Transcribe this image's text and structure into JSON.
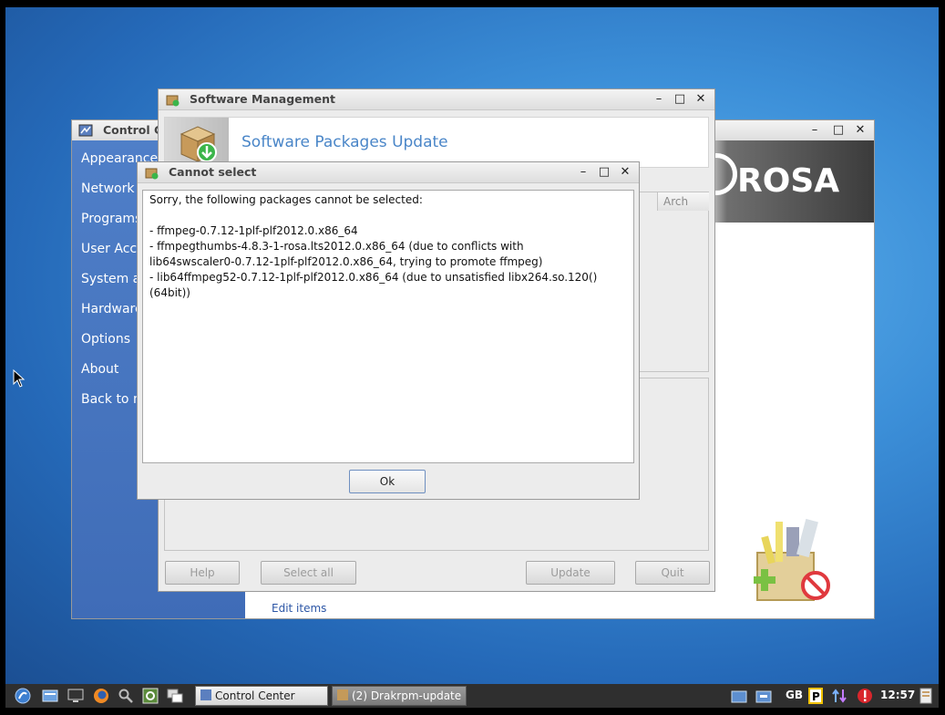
{
  "control_center": {
    "title": "Control C",
    "sidebar": [
      "Appearance",
      "Network &",
      "Programs",
      "User Acco",
      "System ar",
      "Hardware",
      "Options",
      "About",
      "Back to m"
    ],
    "edit_items_link": "Edit items",
    "brand_text": "ROSA"
  },
  "software_management": {
    "title": "Software Management",
    "header_title": "Software Packages Update",
    "column_arch": "Arch",
    "buttons": {
      "help": "Help",
      "select_all": "Select all",
      "update": "Update",
      "quit": "Quit"
    }
  },
  "dialog": {
    "title": "Cannot select",
    "message_lines": [
      "Sorry, the following packages cannot be selected:",
      "",
      "- ffmpeg-0.7.12-1plf-plf2012.0.x86_64",
      "- ffmpegthumbs-4.8.3-1-rosa.lts2012.0.x86_64 (due to conflicts with",
      "lib64swscaler0-0.7.12-1plf-plf2012.0.x86_64, trying to promote ffmpeg)",
      "- lib64ffmpeg52-0.7.12-1plf-plf2012.0.x86_64 (due to unsatisfied libx264.so.120()(64bit))"
    ],
    "ok_label": "Ok"
  },
  "window_controls": {
    "minimize": "–",
    "maximize": "□",
    "close": "✕"
  },
  "taskbar": {
    "tasks": [
      "Control Center",
      "(2) Drakrpm-update"
    ],
    "keyboard_layout": "GB",
    "clock": "12:57"
  },
  "colors": {
    "accent_blue": "#4a86c8",
    "sidebar_blue": "#4674bf",
    "desktop_blue": "#3c8fd8",
    "alert_red": "#d9262c"
  }
}
